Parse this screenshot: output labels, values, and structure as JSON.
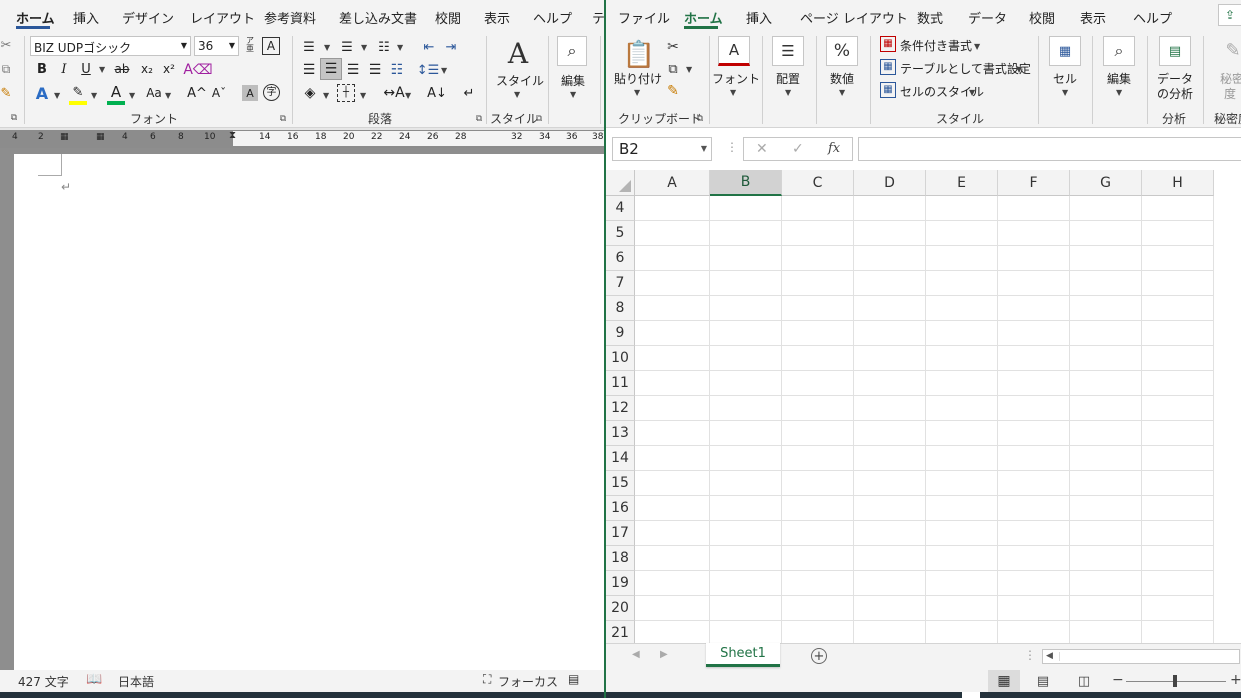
{
  "word": {
    "tabs": [
      "ホーム",
      "挿入",
      "デザイン",
      "レイアウト",
      "参考資料",
      "差し込み文書",
      "校閲",
      "表示",
      "ヘルプ",
      "テ"
    ],
    "font": {
      "name": "BIZ UDPゴシック",
      "size": "36"
    },
    "groups": {
      "font": "フォント",
      "paragraph": "段落",
      "style": "スタイル"
    },
    "big_buttons": {
      "style": "スタイル",
      "edit": "編集"
    },
    "small_icons": {
      "bold": "B",
      "italic": "I",
      "underline": "U",
      "strike": "ab",
      "subscript": "x₂",
      "superscript": "x²",
      "font_color": "A",
      "case": "Aa",
      "grow": "A^",
      "shrink": "Aˇ"
    },
    "ruler_numbers": [
      "4",
      "2",
      "2",
      "4",
      "6",
      "8",
      "10",
      "14",
      "16",
      "18",
      "20",
      "22",
      "24",
      "26",
      "28",
      "32",
      "34",
      "36",
      "38"
    ],
    "doc": {
      "paragraph_mark": "↵"
    },
    "status": {
      "word_count": "427 文字",
      "language": "日本語",
      "focus": "フォーカス"
    }
  },
  "excel": {
    "tabs": [
      "ファイル",
      "ホーム",
      "挿入",
      "ページ レイアウト",
      "数式",
      "データ",
      "校閲",
      "表示",
      "ヘルプ"
    ],
    "active_tab": "ホーム",
    "clipboard": {
      "paste": "貼り付け",
      "group": "クリップボード"
    },
    "font_label": "フォント",
    "align_label": "配置",
    "number_label": "数値",
    "styles": {
      "conditional": "条件付き書式",
      "table": "テーブルとして書式設定",
      "cell_style": "セルのスタイル",
      "group": "スタイル"
    },
    "cells_label": "セル",
    "edit_label": "編集",
    "analyze": {
      "line1": "データ",
      "line2": "の分析",
      "group": "分析"
    },
    "sensitivity": {
      "line1": "秘密",
      "line2": "度",
      "group": "秘密度"
    },
    "name_box": "B2",
    "fx": "fx",
    "columns": [
      "A",
      "B",
      "C",
      "D",
      "E",
      "F",
      "G",
      "H"
    ],
    "selected_column": "B",
    "rows": [
      "4",
      "5",
      "6",
      "7",
      "8",
      "9",
      "10",
      "11",
      "12",
      "13",
      "14",
      "15",
      "16",
      "17",
      "18",
      "19",
      "20",
      "21"
    ],
    "sheet_tab": "Sheet1",
    "add_sheet": "+",
    "colors": {
      "accent": "#217346"
    }
  }
}
